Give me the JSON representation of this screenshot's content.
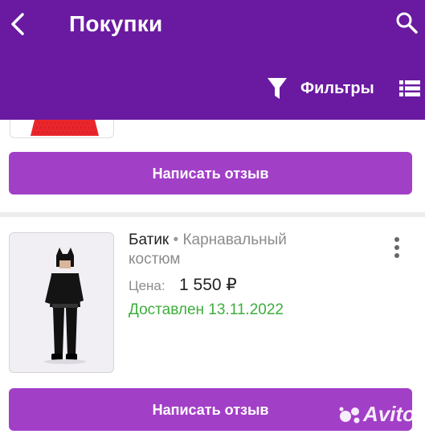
{
  "header": {
    "title": "Покупки",
    "filters_label": "Фильтры"
  },
  "orders": [
    {
      "review_button": "Написать отзыв"
    },
    {
      "brand": "Батик",
      "separator": "•",
      "category": "Карнавальный",
      "category_cont": "костюм",
      "price_label": "Цена:",
      "price": "1 550 ₽",
      "status": "Доставлен 13.11.2022",
      "review_button": "Написать отзыв"
    }
  ],
  "watermark": "Avito",
  "colors": {
    "appbar": "#6a1aa0",
    "button": "#a23fc7",
    "delivered": "#3eae3c"
  },
  "icons": [
    "back-arrow-icon",
    "search-icon",
    "filter-funnel-icon",
    "list-view-icon",
    "more-vertical-icon"
  ]
}
